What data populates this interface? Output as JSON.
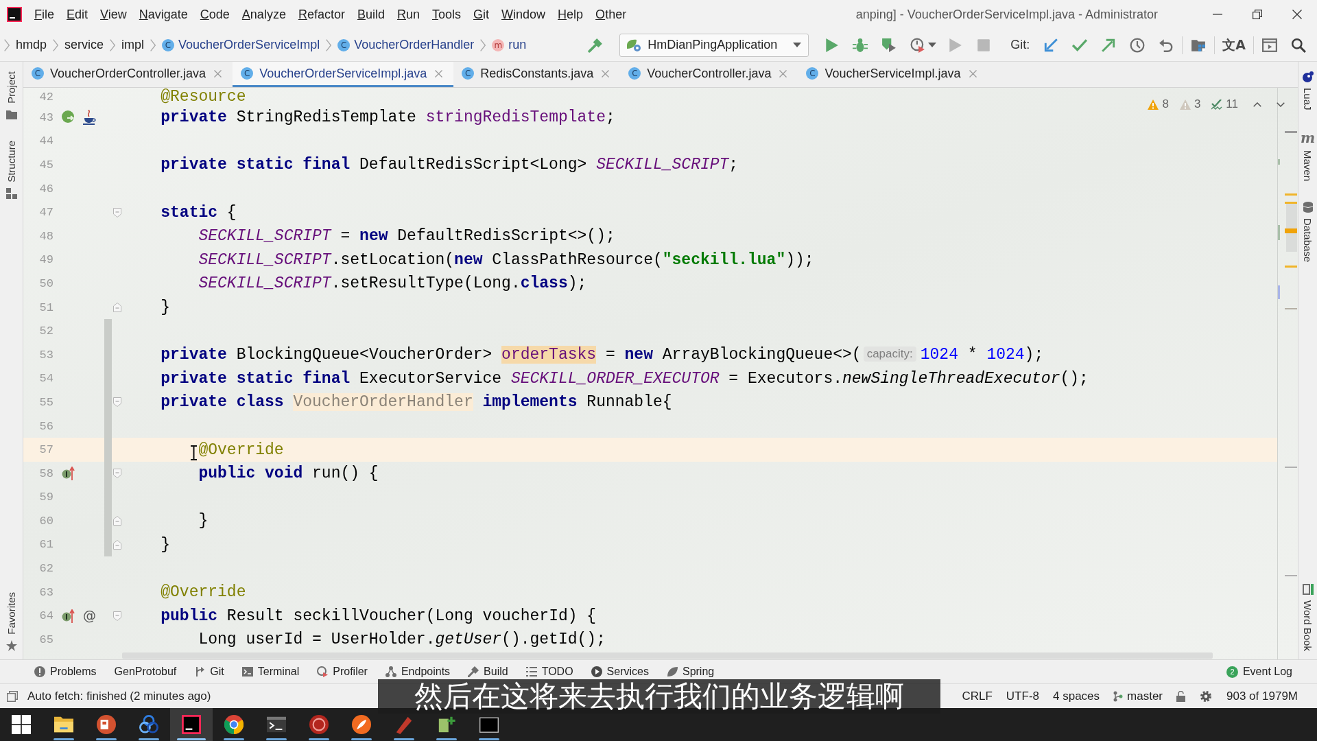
{
  "title_bar": {
    "menu": [
      "File",
      "Edit",
      "View",
      "Navigate",
      "Code",
      "Analyze",
      "Refactor",
      "Build",
      "Run",
      "Tools",
      "Git",
      "Window",
      "Help",
      "Other"
    ],
    "title": "anping] - VoucherOrderServiceImpl.java - Administrator"
  },
  "navigation_bar": {
    "breadcrumbs": [
      {
        "kind": "package",
        "label": "hmdp"
      },
      {
        "kind": "package",
        "label": "service"
      },
      {
        "kind": "package",
        "label": "impl"
      },
      {
        "kind": "class",
        "symbol": "C",
        "label": "VoucherOrderServiceImpl"
      },
      {
        "kind": "class",
        "symbol": "C",
        "label": "VoucherOrderHandler"
      },
      {
        "kind": "method",
        "symbol": "m",
        "label": "run"
      }
    ],
    "toolbar_groups": [
      {
        "items": [
          {
            "kind": "build",
            "disabled": false
          }
        ]
      },
      {
        "run_configuration": "HmDianPingApplication",
        "items": [
          {
            "kind": "run",
            "disabled": false
          },
          {
            "kind": "debug",
            "disabled": false
          },
          {
            "kind": "coverage",
            "disabled": false
          },
          {
            "kind": "profile",
            "disabled": false
          },
          {
            "kind": "dropdown",
            "disabled": false
          },
          {
            "kind": "run",
            "disabled": true
          },
          {
            "kind": "stop",
            "disabled": true
          }
        ]
      },
      {
        "label": "Git:",
        "items": [
          {
            "kind": "update",
            "disabled": false
          },
          {
            "kind": "commit",
            "disabled": false
          },
          {
            "kind": "push",
            "disabled": false
          },
          {
            "kind": "history",
            "disabled": false
          },
          {
            "kind": "rollback",
            "disabled": false
          }
        ]
      },
      {
        "items": [
          {
            "kind": "structure",
            "disabled": false
          }
        ]
      },
      {
        "items": [
          {
            "kind": "translate",
            "glyph": "文A",
            "disabled": false
          }
        ]
      },
      {
        "items": [
          {
            "kind": "presentation",
            "disabled": false
          },
          {
            "kind": "search",
            "disabled": false
          }
        ]
      }
    ]
  },
  "left_strip": {
    "top": [
      {
        "kind": "project",
        "label": "Project"
      },
      {
        "kind": "structure",
        "label": "Structure"
      }
    ],
    "bottom": [
      {
        "kind": "favorites",
        "label": "Favorites"
      }
    ]
  },
  "right_strip": {
    "top": [
      {
        "kind": "luaj",
        "label": "LuaJ"
      },
      {
        "kind": "maven",
        "glyph": "m",
        "label": "Maven"
      },
      {
        "kind": "database",
        "label": "Database"
      }
    ],
    "bottom": [
      {
        "kind": "wordbook",
        "label": "Word Book"
      }
    ]
  },
  "tabs": [
    {
      "symbol": "C",
      "label": "VoucherOrderController.java",
      "selected": false
    },
    {
      "symbol": "C",
      "label": "VoucherOrderServiceImpl.java",
      "selected": true
    },
    {
      "symbol": "C",
      "label": "RedisConstants.java",
      "selected": false
    },
    {
      "symbol": "C",
      "label": "VoucherController.java",
      "selected": false
    },
    {
      "symbol": "C",
      "label": "VoucherServiceImpl.java",
      "selected": false
    }
  ],
  "editor": {
    "inspections": [
      {
        "kind": "warning",
        "count": "8"
      },
      {
        "kind": "weak_warning",
        "count": "3"
      },
      {
        "kind": "typo",
        "count": "11"
      }
    ],
    "lines": [
      {
        "number": "42",
        "current": false,
        "modified": false,
        "tokens": [
          {
            "kind": "anno",
            "text": "@Resource"
          }
        ]
      },
      {
        "number": "43",
        "current": false,
        "modified": false,
        "gutter_icons": [
          {
            "kind": "bean"
          },
          {
            "kind": "java"
          }
        ],
        "tokens": [
          {
            "kind": "kw",
            "text": "private"
          },
          {
            "kind": "plain",
            "text": " StringRedisTemplate "
          },
          {
            "kind": "field",
            "text": "stringRedisTemplate"
          },
          {
            "kind": "plain",
            "text": ";"
          }
        ]
      },
      {
        "number": "44",
        "current": false,
        "modified": false
      },
      {
        "number": "45",
        "current": false,
        "modified": false,
        "tokens": [
          {
            "kind": "kw",
            "text": "private static final"
          },
          {
            "kind": "plain",
            "text": " DefaultRedisScript<Long> "
          },
          {
            "kind": "const",
            "text": "SECKILL_SCRIPT"
          },
          {
            "kind": "plain",
            "text": ";"
          }
        ]
      },
      {
        "number": "46",
        "current": false,
        "modified": false
      },
      {
        "number": "47",
        "current": false,
        "modified": false,
        "fold": {
          "kind": "start"
        },
        "tokens": [
          {
            "kind": "kw",
            "text": "static"
          },
          {
            "kind": "plain",
            "text": " {"
          }
        ],
        "children": [
          {
            "number": "48",
            "current": false,
            "modified": false,
            "tokens": [
              {
                "kind": "const",
                "text": "SECKILL_SCRIPT"
              },
              {
                "kind": "plain",
                "text": " = "
              },
              {
                "kind": "kw",
                "text": "new"
              },
              {
                "kind": "plain",
                "text": " DefaultRedisScript<>();"
              }
            ]
          },
          {
            "number": "49",
            "current": false,
            "modified": false,
            "tokens": [
              {
                "kind": "const",
                "text": "SECKILL_SCRIPT"
              },
              {
                "kind": "plain",
                "text": ".setLocation("
              },
              {
                "kind": "kw",
                "text": "new"
              },
              {
                "kind": "plain",
                "text": " ClassPathResource("
              },
              {
                "kind": "str",
                "text": "\"seckill.lua\""
              },
              {
                "kind": "plain",
                "text": "));"
              }
            ]
          },
          {
            "number": "50",
            "current": false,
            "modified": false,
            "tokens": [
              {
                "kind": "const",
                "text": "SECKILL_SCRIPT"
              },
              {
                "kind": "plain",
                "text": ".setResultType(Long."
              },
              {
                "kind": "kw",
                "text": "class"
              },
              {
                "kind": "plain",
                "text": ");"
              }
            ]
          }
        ]
      },
      {
        "number": "51",
        "current": false,
        "modified": false,
        "fold": {
          "kind": "end"
        },
        "tokens": [
          {
            "kind": "plain",
            "text": "}"
          }
        ]
      },
      {
        "number": "52",
        "current": false,
        "modified": true
      },
      {
        "number": "53",
        "current": false,
        "modified": true,
        "tokens": [
          {
            "kind": "kw",
            "text": "private"
          },
          {
            "kind": "plain",
            "text": " BlockingQueue<VoucherOrder> "
          },
          {
            "kind": "usage",
            "text": "orderTasks"
          },
          {
            "kind": "plain",
            "text": " = "
          },
          {
            "kind": "kw",
            "text": "new"
          },
          {
            "kind": "plain",
            "text": " ArrayBlockingQueue<>("
          },
          {
            "kind": "hint",
            "text": "capacity:"
          },
          {
            "kind": "num",
            "text": "1024"
          },
          {
            "kind": "plain",
            "text": " * "
          },
          {
            "kind": "num",
            "text": "1024"
          },
          {
            "kind": "plain",
            "text": ");"
          }
        ]
      },
      {
        "number": "54",
        "current": false,
        "modified": true,
        "tokens": [
          {
            "kind": "kw",
            "text": "private static final"
          },
          {
            "kind": "plain",
            "text": " ExecutorService "
          },
          {
            "kind": "const",
            "text": "SECKILL_ORDER_EXECUTOR"
          },
          {
            "kind": "plain",
            "text": " = Executors."
          },
          {
            "kind": "call",
            "text": "newSingleThreadExecutor"
          },
          {
            "kind": "plain",
            "text": "();"
          }
        ]
      },
      {
        "number": "55",
        "current": false,
        "modified": true,
        "fold": {
          "kind": "start"
        },
        "tokens": [
          {
            "kind": "kw",
            "text": "private class "
          },
          {
            "kind": "unused",
            "text": "VoucherOrderHandler"
          },
          {
            "kind": "kw",
            "text": " implements"
          },
          {
            "kind": "plain",
            "text": " Runnable{"
          }
        ],
        "children": [
          {
            "number": "56",
            "current": false,
            "modified": true
          },
          {
            "number": "57",
            "current": true,
            "modified": true,
            "tokens": [
              {
                "kind": "anno",
                "text": "@Override"
              }
            ]
          },
          {
            "number": "58",
            "current": false,
            "modified": true,
            "fold": {
              "kind": "start"
            },
            "gutter_icons": [
              {
                "kind": "implements"
              }
            ],
            "tokens": [
              {
                "kind": "kw",
                "text": "public void"
              },
              {
                "kind": "plain",
                "text": " run() {"
              }
            ]
          },
          {
            "number": "59",
            "current": false,
            "modified": true
          },
          {
            "number": "60",
            "current": false,
            "modified": true,
            "fold": {
              "kind": "end"
            },
            "tokens": [
              {
                "kind": "plain",
                "text": "}"
              }
            ]
          }
        ]
      },
      {
        "number": "61",
        "current": false,
        "modified": true,
        "fold": {
          "kind": "end"
        },
        "tokens": [
          {
            "kind": "plain",
            "text": "}"
          }
        ]
      },
      {
        "number": "62",
        "current": false,
        "modified": false
      },
      {
        "number": "63",
        "current": false,
        "modified": false,
        "tokens": [
          {
            "kind": "anno",
            "text": "@Override"
          }
        ]
      },
      {
        "number": "64",
        "current": false,
        "modified": false,
        "fold": {
          "kind": "start"
        },
        "gutter_icons": [
          {
            "kind": "implements"
          },
          {
            "kind": "symbol",
            "text": "@"
          }
        ],
        "tokens": [
          {
            "kind": "kw",
            "text": "public"
          },
          {
            "kind": "plain",
            "text": " Result seckillVoucher(Long voucherId) {"
          }
        ],
        "children": [
          {
            "number": "65",
            "current": false,
            "modified": false,
            "tokens": [
              {
                "kind": "plain",
                "text": "Long userId = UserHolder."
              },
              {
                "kind": "call",
                "text": "getUser"
              },
              {
                "kind": "plain",
                "text": "().getId();"
              }
            ]
          }
        ]
      }
    ]
  },
  "tool_window_bar": {
    "left": [
      {
        "kind": "problems",
        "label": "Problems"
      },
      {
        "kind": "plain",
        "label": "GenProtobuf"
      },
      {
        "kind": "git",
        "label": "Git"
      },
      {
        "kind": "terminal",
        "label": "Terminal"
      },
      {
        "kind": "profiler",
        "label": "Profiler"
      },
      {
        "kind": "endpoints",
        "label": "Endpoints"
      },
      {
        "kind": "build",
        "label": "Build"
      },
      {
        "kind": "todo",
        "label": "TODO"
      },
      {
        "kind": "services",
        "label": "Services"
      },
      {
        "kind": "spring",
        "label": "Spring"
      }
    ],
    "right": [
      {
        "kind": "event_log",
        "badge": "2",
        "label": "Event Log"
      }
    ]
  },
  "status_bar": {
    "message": "Auto fetch: finished (2 minutes ago)",
    "items": [
      {
        "kind": "text",
        "label": "CRLF"
      },
      {
        "kind": "text",
        "label": "UTF-8"
      },
      {
        "kind": "text",
        "label": "4 spaces"
      },
      {
        "kind": "branch",
        "label": "master"
      },
      {
        "kind": "lock"
      },
      {
        "kind": "gear"
      },
      {
        "kind": "text",
        "label": "903 of 1979M"
      }
    ]
  },
  "taskbar": [
    {
      "kind": "start",
      "selected": false,
      "running": false
    },
    {
      "kind": "folder",
      "selected": false,
      "running": true
    },
    {
      "kind": "slides",
      "selected": false,
      "running": true
    },
    {
      "kind": "rings",
      "selected": false,
      "running": true
    },
    {
      "kind": "ide",
      "selected": true,
      "running": true
    },
    {
      "kind": "browser",
      "selected": false,
      "running": true
    },
    {
      "kind": "terminal",
      "selected": false,
      "running": true
    },
    {
      "kind": "disc",
      "selected": false,
      "running": true
    },
    {
      "kind": "feather",
      "selected": false,
      "running": true
    },
    {
      "kind": "diagonal",
      "selected": false,
      "running": true
    },
    {
      "kind": "plus",
      "selected": false,
      "running": true
    },
    {
      "kind": "console",
      "selected": false,
      "running": true
    }
  ],
  "subtitle": "然后在这将来去执行我们的业务逻辑啊"
}
